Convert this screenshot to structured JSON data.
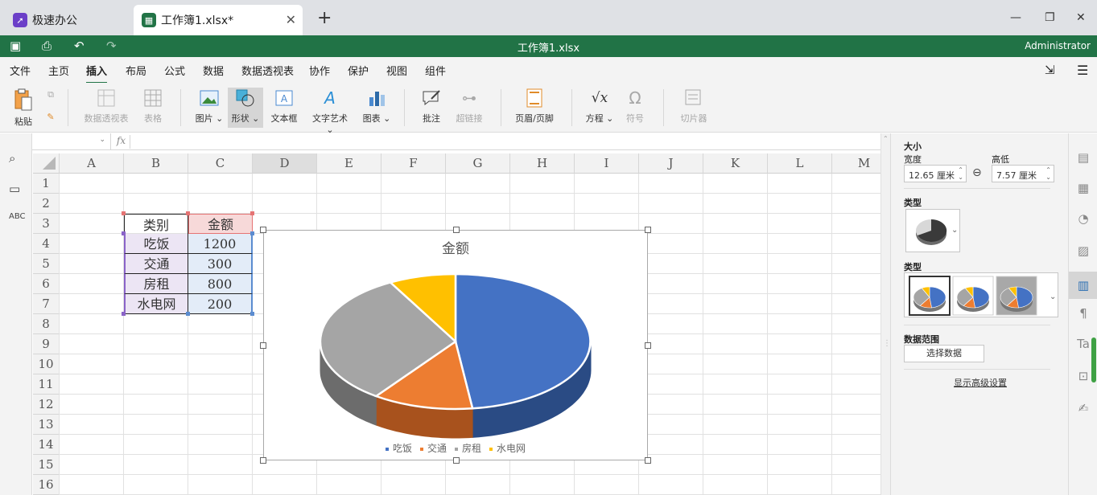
{
  "tabs": {
    "app": "极速办公",
    "doc": "工作簿1.xlsx*"
  },
  "titlebar": {
    "title": "工作簿1.xlsx",
    "user": "Administrator"
  },
  "menu": [
    "文件",
    "主页",
    "插入",
    "布局",
    "公式",
    "数据",
    "数据透视表",
    "协作",
    "保护",
    "视图",
    "组件"
  ],
  "menu_active": "插入",
  "ribbon": {
    "paste": "粘贴",
    "pivot": "数据透视表",
    "table": "表格",
    "picture": "图片",
    "shape": "形状",
    "textbox": "文本框",
    "wordart": "文字艺术",
    "chart": "图表",
    "comment": "批注",
    "hyperlink": "超链接",
    "headerfooter": "页眉/页脚",
    "equation": "方程",
    "symbol": "符号",
    "slicer": "切片器"
  },
  "formula": {
    "fx": "fx"
  },
  "columns": [
    "A",
    "B",
    "C",
    "D",
    "E",
    "F",
    "G",
    "H",
    "I",
    "J",
    "K",
    "L",
    "M"
  ],
  "rows": [
    "1",
    "2",
    "3",
    "4",
    "5",
    "6",
    "7",
    "8",
    "9",
    "10",
    "11",
    "12",
    "13",
    "14",
    "15",
    "16"
  ],
  "table": {
    "header": {
      "category": "类别",
      "amount": "金额"
    },
    "rows": [
      {
        "category": "吃饭",
        "amount": "1200"
      },
      {
        "category": "交通",
        "amount": "300"
      },
      {
        "category": "房租",
        "amount": "800"
      },
      {
        "category": "水电网",
        "amount": "200"
      }
    ]
  },
  "chart_data": {
    "type": "pie",
    "title": "金额",
    "categories": [
      "吃饭",
      "交通",
      "房租",
      "水电网"
    ],
    "values": [
      1200,
      300,
      800,
      200
    ],
    "colors": [
      "#4472c4",
      "#ed7d31",
      "#a5a5a5",
      "#ffc000"
    ],
    "side_colors": [
      "#2a4b84",
      "#a8521d",
      "#6c6c6c",
      "#b8890a"
    ],
    "legend": "bottom",
    "style": "3d"
  },
  "panel": {
    "size_title": "大小",
    "width_label": "宽度",
    "height_label": "高低",
    "width_value": "12.65 厘米",
    "height_value": "7.57 厘米",
    "type_label": "类型",
    "style_label": "类型",
    "range_label": "数据范围",
    "select_button": "选择数据",
    "advanced_link": "显示高级设置"
  },
  "accent": "#217346"
}
